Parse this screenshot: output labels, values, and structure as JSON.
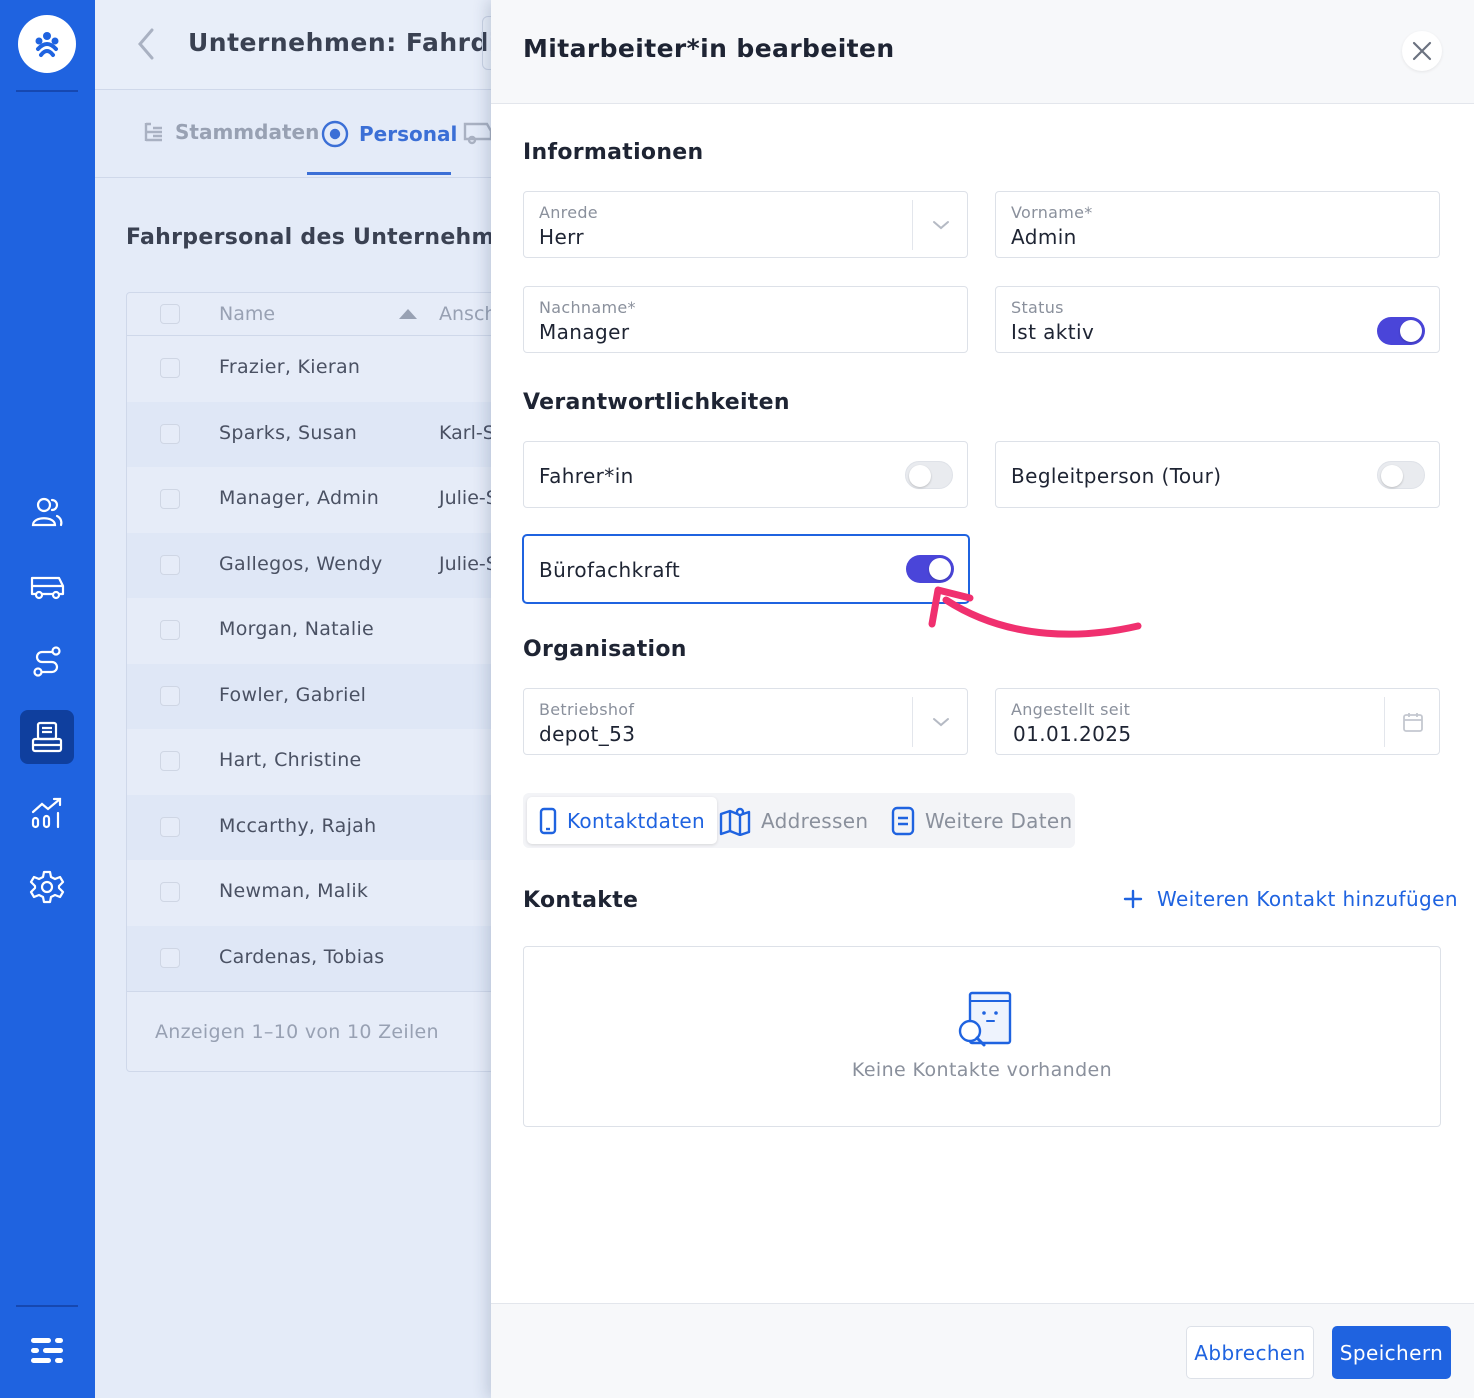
{
  "sidebar": {
    "icons": [
      "logo-icon",
      "users-icon",
      "bus-icon",
      "route-icon",
      "office-icon",
      "analytics-icon",
      "settings-icon",
      "menu-icon"
    ],
    "brand_color": "#1f63e0"
  },
  "page": {
    "title": "Unternehmen: Fahrdie",
    "tabs": [
      {
        "label": "Stammdaten",
        "active": false
      },
      {
        "label": "Personal",
        "active": true
      }
    ],
    "section_title": "Fahrpersonal des Unternehmens",
    "table": {
      "columns": [
        "Name",
        "Ansch"
      ],
      "rows": [
        {
          "name": "Frazier, Kieran",
          "ansch": ""
        },
        {
          "name": "Sparks, Susan",
          "ansch": "Karl-S"
        },
        {
          "name": "Manager, Admin",
          "ansch": "Julie-S"
        },
        {
          "name": "Gallegos, Wendy",
          "ansch": "Julie-S"
        },
        {
          "name": "Morgan, Natalie",
          "ansch": ""
        },
        {
          "name": "Fowler, Gabriel",
          "ansch": ""
        },
        {
          "name": "Hart, Christine",
          "ansch": ""
        },
        {
          "name": "Mccarthy, Rajah",
          "ansch": ""
        },
        {
          "name": "Newman, Malik",
          "ansch": ""
        },
        {
          "name": "Cardenas, Tobias",
          "ansch": ""
        }
      ],
      "pager": "Anzeigen 1–10 von 10 Zeilen"
    }
  },
  "drawer": {
    "title": "Mitarbeiter*in bearbeiten",
    "info": {
      "heading": "Informationen",
      "anrede_label": "Anrede",
      "anrede_value": "Herr",
      "vorname_label": "Vorname*",
      "vorname_value": "Admin",
      "nachname_label": "Nachname*",
      "nachname_value": "Manager",
      "status_label": "Status",
      "status_value": "Ist aktiv",
      "status_on": true
    },
    "resp": {
      "heading": "Verantwortlichkeiten",
      "fahrer_label": "Fahrer*in",
      "fahrer_on": false,
      "begleit_label": "Begleitperson (Tour)",
      "begleit_on": false,
      "buero_label": "Bürofachkraft",
      "buero_on": true
    },
    "org": {
      "heading": "Organisation",
      "betriebshof_label": "Betriebshof",
      "betriebshof_value": "depot_53",
      "angestellt_label": "Angestellt seit",
      "angestellt_value": "01.01.2025"
    },
    "subtabs": [
      {
        "label": "Kontaktdaten",
        "active": true
      },
      {
        "label": "Addressen",
        "active": false
      },
      {
        "label": "Weitere Daten",
        "active": false
      }
    ],
    "contacts": {
      "heading": "Kontakte",
      "add_label": "Weiteren Kontakt hinzufügen",
      "empty_text": "Keine Kontakte vorhanden"
    },
    "footer": {
      "cancel_label": "Abbrechen",
      "save_label": "Speichern"
    },
    "toggle_on_color": "#4a45d9",
    "annotation_color": "#f0306f"
  }
}
